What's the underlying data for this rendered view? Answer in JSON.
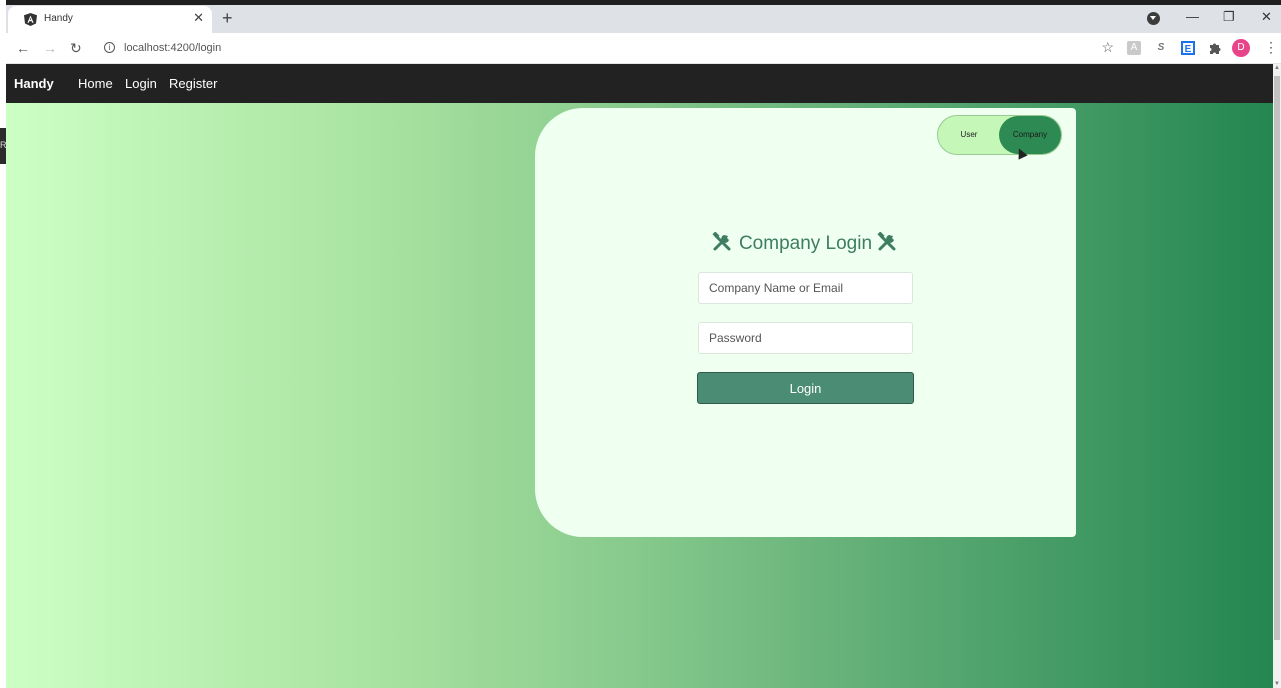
{
  "browser": {
    "tab_title": "Handy",
    "tab_close": "✕",
    "new_tab": "+",
    "url": "localhost:4200/login",
    "back": "←",
    "forward": "→",
    "reload": "↻",
    "bookmark": "☆",
    "profile_initial": "D",
    "menu": "⋮",
    "window_controls": {
      "minimize": "—",
      "maximize": "❐",
      "close": "✕"
    }
  },
  "navbar": {
    "brand": "Handy",
    "links": [
      "Home",
      "Login",
      "Register"
    ]
  },
  "toggle": {
    "user_label": "User",
    "company_label": "Company",
    "selected": "Company"
  },
  "login": {
    "title": "Company Login",
    "identifier_placeholder": "Company Name or Email",
    "password_placeholder": "Password",
    "submit_label": "Login"
  },
  "colors": {
    "gradient_start": "#ccffc4",
    "gradient_end": "#248650",
    "card_bg": "#effff0",
    "button": "#4a8c74",
    "title": "#3e7d62"
  }
}
